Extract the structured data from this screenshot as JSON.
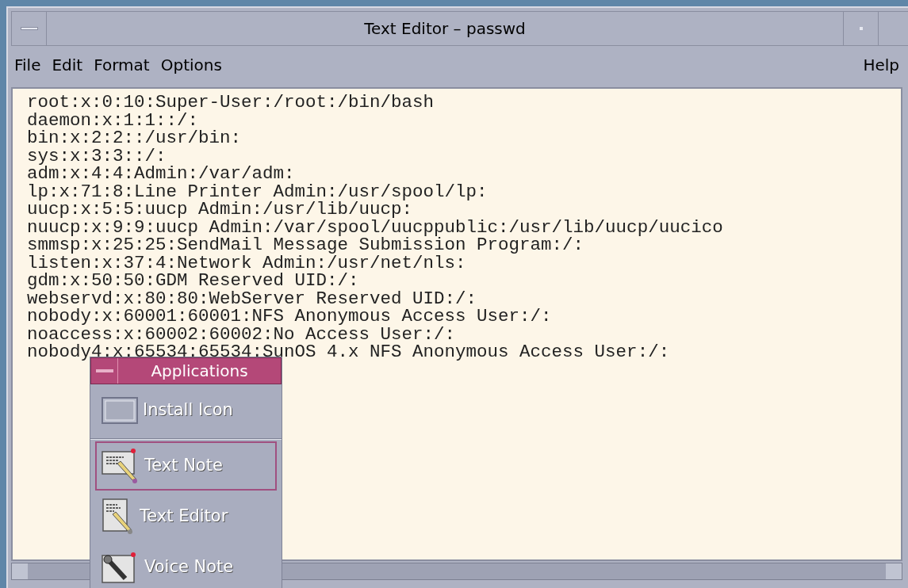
{
  "window": {
    "title": "Text Editor – passwd"
  },
  "menu_bar": {
    "items": [
      "File",
      "Edit",
      "Format",
      "Options"
    ],
    "help": "Help"
  },
  "document": {
    "lines": [
      "root:x:0:10:Super-User:/root:/bin/bash",
      "daemon:x:1:1::/:",
      "bin:x:2:2::/usr/bin:",
      "sys:x:3:3::/:",
      "adm:x:4:4:Admin:/var/adm:",
      "lp:x:71:8:Line Printer Admin:/usr/spool/lp:",
      "uucp:x:5:5:uucp Admin:/usr/lib/uucp:",
      "nuucp:x:9:9:uucp Admin:/var/spool/uucppublic:/usr/lib/uucp/uucico",
      "smmsp:x:25:25:SendMail Message Submission Program:/:",
      "listen:x:37:4:Network Admin:/usr/net/nls:",
      "gdm:x:50:50:GDM Reserved UID:/:",
      "webservd:x:80:80:WebServer Reserved UID:/:",
      "nobody:x:60001:60001:NFS Anonymous Access User:/:",
      "noaccess:x:60002:60002:No Access User:/:",
      "nobody4:x:65534:65534:SunOS 4.x NFS Anonymous Access User:/:"
    ]
  },
  "popup_menu": {
    "title": "Applications",
    "items": [
      {
        "label": "Install Icon",
        "kind": "install",
        "selected": false
      },
      {
        "label": "Text Note",
        "kind": "note",
        "selected": true
      },
      {
        "label": "Text Editor",
        "kind": "editor",
        "selected": false
      },
      {
        "label": "Voice Note",
        "kind": "voice",
        "selected": false
      }
    ]
  }
}
